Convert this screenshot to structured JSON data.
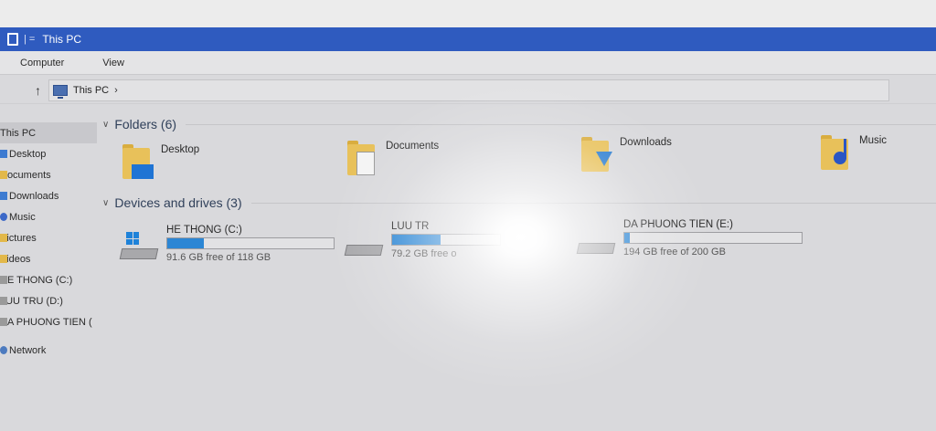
{
  "window": {
    "title": "This PC",
    "title_sep": "|  ="
  },
  "ribbon": {
    "tabs": [
      "Computer",
      "View"
    ]
  },
  "address": {
    "up_icon": "up-arrow-icon",
    "crumb": "This PC",
    "chev": "›"
  },
  "nav": {
    "items": [
      {
        "label": "This PC",
        "icon": "pc-icon",
        "selected": true
      },
      {
        "label": "Desktop",
        "icon": "desktop-icon"
      },
      {
        "label": "Documents",
        "icon": "documents-icon"
      },
      {
        "label": "Downloads",
        "icon": "downloads-icon"
      },
      {
        "label": "Music",
        "icon": "music-icon"
      },
      {
        "label": "Pictures",
        "icon": "pictures-icon"
      },
      {
        "label": "Videos",
        "icon": "videos-icon"
      },
      {
        "label": "HE THONG (C:)",
        "icon": "drive-icon"
      },
      {
        "label": "LUU TRU (D:)",
        "icon": "drive-icon"
      },
      {
        "label": "DA PHUONG TIEN (",
        "icon": "drive-icon"
      },
      {
        "label": "Network",
        "icon": "network-icon"
      }
    ]
  },
  "folders": {
    "heading": "Folders (6)",
    "items": [
      {
        "label": "Desktop"
      },
      {
        "label": "Documents"
      },
      {
        "label": "Downloads"
      },
      {
        "label": "Music"
      }
    ]
  },
  "drives": {
    "heading": "Devices and drives (3)",
    "items": [
      {
        "name": "HE THONG (C:)",
        "free": "91.6 GB free of 118 GB",
        "used_fraction": 0.22
      },
      {
        "name": "LUU TR",
        "free": "79.2 GB free o",
        "used_fraction": 0.45
      },
      {
        "name": "DA PHUONG TIEN (E:)",
        "free": "194 GB free of 200 GB",
        "used_fraction": 0.03
      }
    ]
  },
  "colors": {
    "accent": "#2f5bbf",
    "bar_fill": "#2c86d4",
    "folder": "#e8c15a"
  }
}
